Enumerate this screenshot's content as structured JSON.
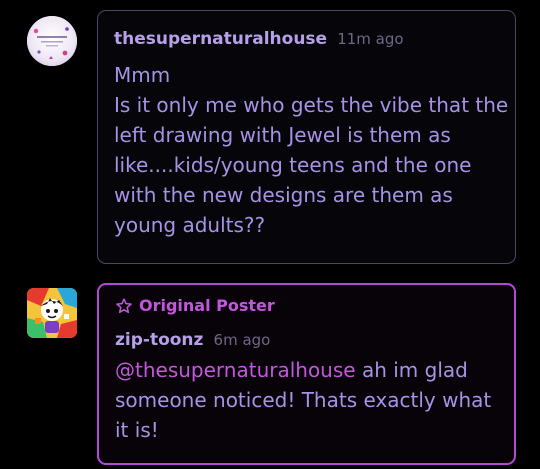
{
  "thread": {
    "comments": [
      {
        "username": "thesupernaturalhouse",
        "timestamp": "11m ago",
        "text": "Mmm\nIs it only me who gets the vibe that the left drawing with Jewel is them as like....kids/young teens and the one with the new designs are them as young adults??",
        "avatar_icon": "profile-avatar-icon"
      },
      {
        "badge": "Original Poster",
        "badge_icon": "star-icon",
        "username": "zip-toonz",
        "timestamp": "6m ago",
        "mention": "@thesupernaturalhouse",
        "text": " ah im glad someone noticed! Thats exactly what it is!",
        "avatar_icon": "profile-avatar-icon"
      }
    ]
  },
  "colors": {
    "background": "#000000",
    "username": "#b7a0ea",
    "body_text": "#a792e6",
    "timestamp": "#6f6786",
    "op_accent": "#c257de",
    "bubble_border": "#4e4668",
    "op_bubble_border": "#b24ad6"
  }
}
